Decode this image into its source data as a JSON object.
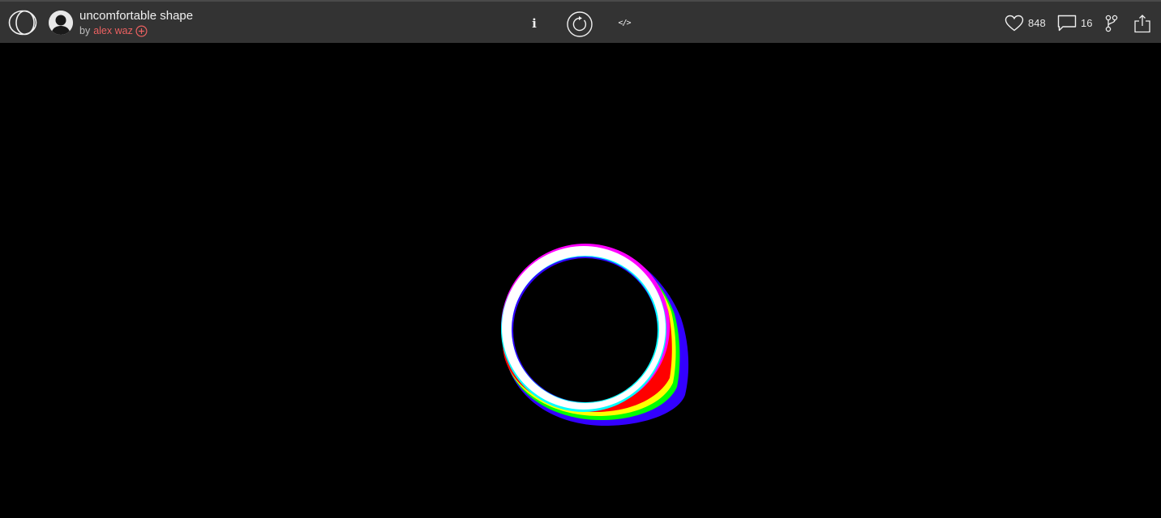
{
  "header": {
    "sketch_title": "uncomfortable shape",
    "by_label": "by",
    "author_name": "alex waz"
  },
  "toolbar": {
    "info_label": "i",
    "code_label": "</>"
  },
  "stats": {
    "hearts": "848",
    "comments": "16"
  },
  "icons": {
    "logo": "openprocessing-logo-icon",
    "follow": "plus-circle-icon",
    "restart": "restart-icon",
    "heart": "heart-icon",
    "comment": "comment-icon",
    "fork": "fork-icon",
    "share": "share-icon"
  },
  "colors": {
    "topbar_bg": "#333333",
    "author_link": "#ec6161",
    "canvas_bg": "#000000",
    "ring_colors": [
      "#ff0000",
      "#ffff00",
      "#00ff00",
      "#00ffff",
      "#3300ff",
      "#ff00ff",
      "#ffffff"
    ]
  }
}
